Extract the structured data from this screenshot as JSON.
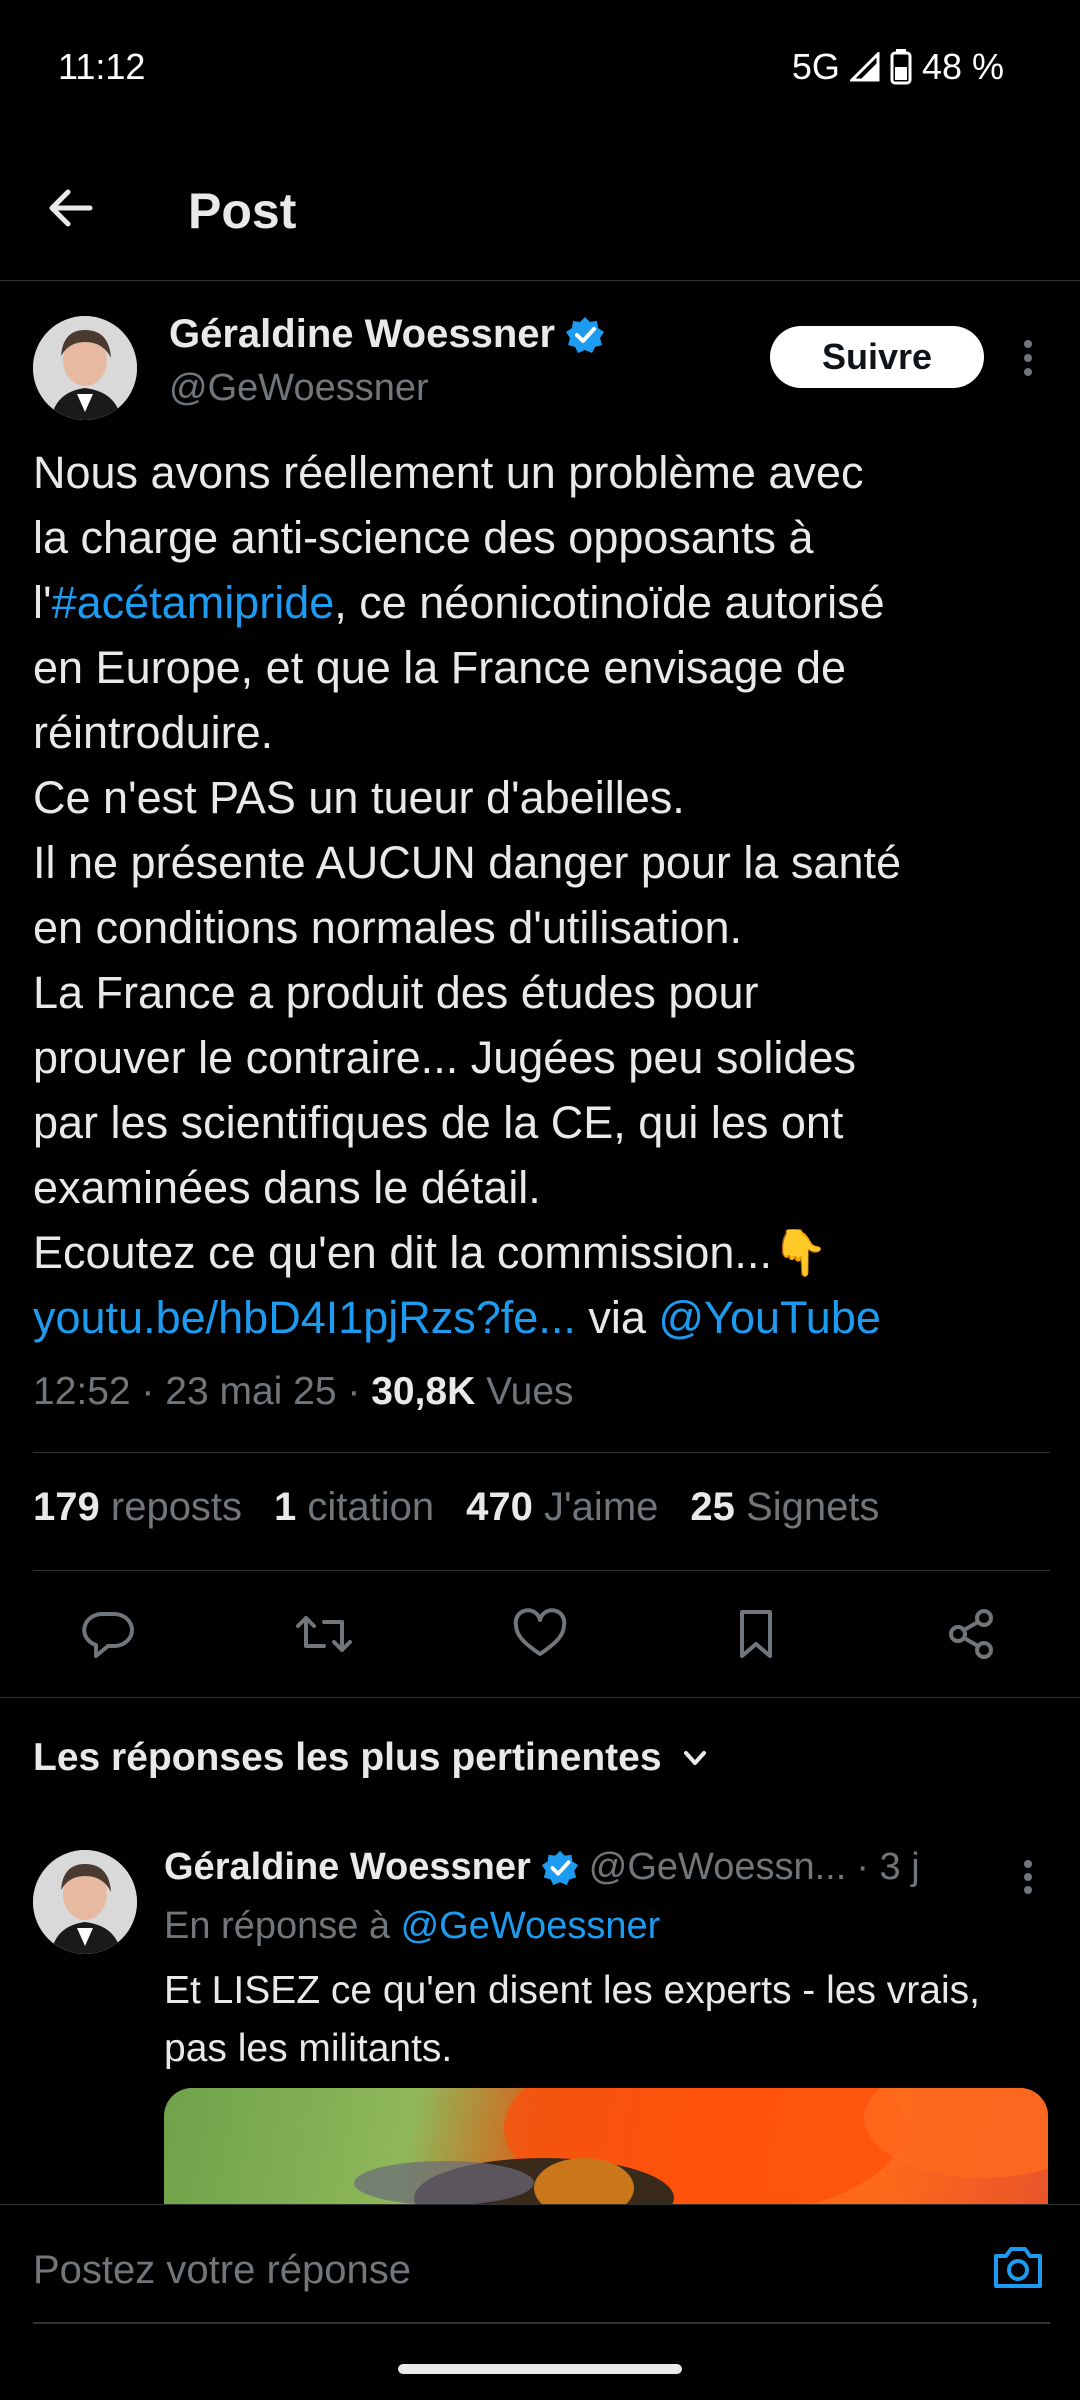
{
  "status": {
    "time": "11:12",
    "network": "5G",
    "battery": "48 %"
  },
  "header": {
    "title": "Post"
  },
  "tweet": {
    "author_name": "Géraldine Woessner",
    "handle": "@GeWoessner",
    "follow_label": "Suivre",
    "text_pre": "Nous avons réellement un problème avec\nla charge anti-science des opposants à\nl'",
    "hashtag": "#acétamipride",
    "text_post": ", ce néonicotinoïde autorisé\nen Europe, et que la France envisage de\nréintroduire.\nCe n'est PAS un tueur d'abeilles.\nIl ne présente AUCUN danger pour la santé\nen conditions normales d'utilisation.\nLa France a produit des études pour\nprouver le contraire... Jugées peu solides\npar les scientifiques de la CE, qui les ont\nexaminées dans le détail.\nEcoutez ce qu'en dit la commission...👇\n",
    "url": "youtu.be/hbD4I1pjRzs?fe...",
    "via": " via ",
    "mention": "@YouTube",
    "time_date": "12:52 · 23 mai 25 · ",
    "views_count": "30,8K",
    "views_label": " Vues"
  },
  "stats": {
    "reposts_count": "179",
    "reposts_label": "reposts",
    "quotes_count": "1",
    "quotes_label": "citation",
    "likes_count": "470",
    "likes_label": "J'aime",
    "bookmarks_count": "25",
    "bookmarks_label": "Signets"
  },
  "actions": [
    "reply-icon",
    "repost-icon",
    "like-icon",
    "bookmark-icon",
    "share-icon"
  ],
  "replies_section": {
    "title": "Les réponses les plus pertinentes"
  },
  "reply": {
    "author_name": "Géraldine Woessner",
    "handle": "@GeWoessn...",
    "age": "· 3 j",
    "in_reply_prefix": "En réponse à ",
    "in_reply_handle": "@GeWoessner",
    "text": "Et LISEZ ce qu'en disent les experts - les vrais, pas les militants."
  },
  "composer": {
    "placeholder": "Postez votre réponse"
  },
  "colors": {
    "accent": "#1d9bf0",
    "verified": "#1d9bf0",
    "muted": "#71767b",
    "background": "#000000"
  }
}
